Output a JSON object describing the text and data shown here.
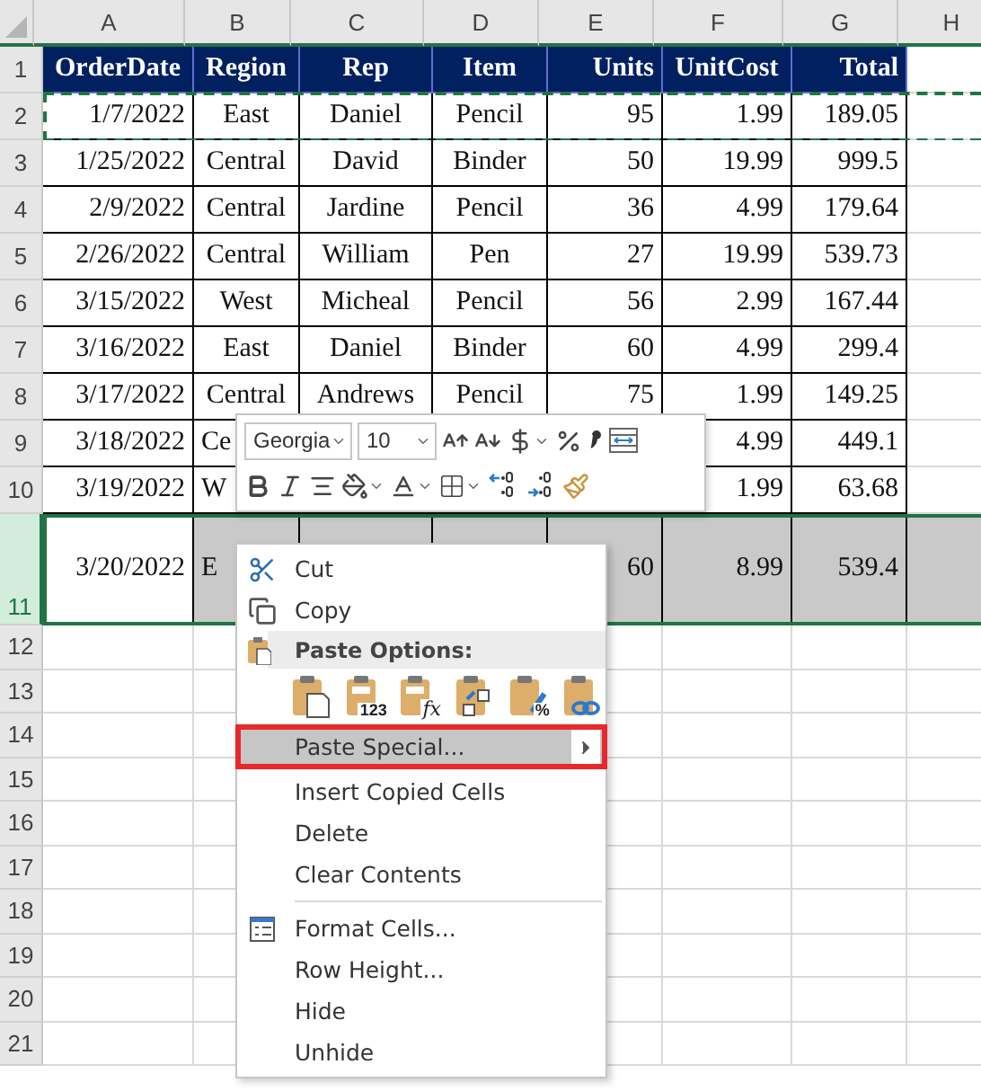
{
  "sheet": {
    "columns": [
      "A",
      "B",
      "C",
      "D",
      "E",
      "F",
      "G",
      "H"
    ],
    "rows": [
      {
        "label": "1",
        "kind": "header",
        "selected": false,
        "copied": false,
        "cells": [
          "OrderDate",
          "Region",
          "Rep",
          "Item",
          "Units",
          "UnitCost",
          "Total"
        ]
      },
      {
        "label": "2",
        "kind": "data",
        "selected": false,
        "copied": true,
        "cells": [
          "1/7/2022",
          "East",
          "Daniel",
          "Pencil",
          "95",
          "1.99",
          "189.05"
        ]
      },
      {
        "label": "3",
        "kind": "data",
        "selected": false,
        "copied": false,
        "cells": [
          "1/25/2022",
          "Central",
          "David",
          "Binder",
          "50",
          "19.99",
          "999.5"
        ]
      },
      {
        "label": "4",
        "kind": "data",
        "selected": false,
        "copied": false,
        "cells": [
          "2/9/2022",
          "Central",
          "Jardine",
          "Pencil",
          "36",
          "4.99",
          "179.64"
        ]
      },
      {
        "label": "5",
        "kind": "data",
        "selected": false,
        "copied": false,
        "cells": [
          "2/26/2022",
          "Central",
          "William",
          "Pen",
          "27",
          "19.99",
          "539.73"
        ]
      },
      {
        "label": "6",
        "kind": "data",
        "selected": false,
        "copied": false,
        "cells": [
          "3/15/2022",
          "West",
          "Micheal",
          "Pencil",
          "56",
          "2.99",
          "167.44"
        ]
      },
      {
        "label": "7",
        "kind": "data",
        "selected": false,
        "copied": false,
        "cells": [
          "3/16/2022",
          "East",
          "Daniel",
          "Binder",
          "60",
          "4.99",
          "299.4"
        ]
      },
      {
        "label": "8",
        "kind": "data",
        "selected": false,
        "copied": false,
        "cells": [
          "3/17/2022",
          "Central",
          "Andrews",
          "Pencil",
          "75",
          "1.99",
          "149.25"
        ]
      },
      {
        "label": "9",
        "kind": "data",
        "selected": false,
        "copied": false,
        "cells": [
          "3/18/2022",
          {
            "text": "Ce",
            "cut": true
          },
          null,
          null,
          null,
          "4.99",
          "449.1"
        ]
      },
      {
        "label": "10",
        "kind": "data",
        "selected": false,
        "copied": false,
        "cells": [
          "3/19/2022",
          {
            "text": "W",
            "cut": true
          },
          null,
          null,
          null,
          "1.99",
          "63.68"
        ]
      },
      {
        "label": "11",
        "kind": "data",
        "selected": true,
        "copied": false,
        "cells": [
          "3/20/2022",
          {
            "text": "E",
            "cut": true
          },
          null,
          null,
          "60",
          "8.99",
          "539.4"
        ]
      },
      {
        "label": "12",
        "kind": "empty",
        "selected": false,
        "copied": false
      },
      {
        "label": "13",
        "kind": "empty",
        "selected": false,
        "copied": false
      },
      {
        "label": "14",
        "kind": "empty",
        "selected": false,
        "copied": false
      },
      {
        "label": "15",
        "kind": "empty",
        "selected": false,
        "copied": false
      },
      {
        "label": "16",
        "kind": "empty",
        "selected": false,
        "copied": false
      },
      {
        "label": "17",
        "kind": "empty",
        "selected": false,
        "copied": false
      },
      {
        "label": "18",
        "kind": "empty",
        "selected": false,
        "copied": false
      },
      {
        "label": "19",
        "kind": "empty",
        "selected": false,
        "copied": false
      },
      {
        "label": "20",
        "kind": "empty",
        "selected": false,
        "copied": false
      },
      {
        "label": "21",
        "kind": "empty",
        "selected": false,
        "copied": false
      }
    ]
  },
  "mini_toolbar": {
    "font": "Georgia",
    "size": "10"
  },
  "context_menu": {
    "items": [
      {
        "kind": "command",
        "label": "Cut",
        "highlighted": false,
        "marked": false
      },
      {
        "kind": "command",
        "label": "Copy",
        "highlighted": false,
        "marked": false
      },
      {
        "kind": "header",
        "label": "Paste Options:"
      },
      {
        "kind": "paste_options",
        "options": [
          {
            "kind": "paste"
          },
          {
            "kind": "values",
            "badge": "123"
          },
          {
            "kind": "formulas",
            "badge": "fx"
          },
          {
            "kind": "transpose"
          },
          {
            "kind": "formatting",
            "badge": "%"
          },
          {
            "kind": "link"
          }
        ]
      },
      {
        "kind": "submenu",
        "label": "Paste Special...",
        "highlighted": true,
        "marked": true
      },
      {
        "kind": "command",
        "label": "Insert Copied Cells",
        "highlighted": false,
        "marked": false
      },
      {
        "kind": "command",
        "label": "Delete",
        "highlighted": false,
        "marked": false
      },
      {
        "kind": "command",
        "label": "Clear Contents",
        "highlighted": false,
        "marked": false
      },
      {
        "kind": "separator"
      },
      {
        "kind": "command",
        "label": "Format Cells...",
        "highlighted": false,
        "marked": false
      },
      {
        "kind": "command",
        "label": "Row Height...",
        "highlighted": false,
        "marked": false
      },
      {
        "kind": "command",
        "label": "Hide",
        "highlighted": false,
        "marked": false
      },
      {
        "kind": "command",
        "label": "Unhide",
        "highlighted": false,
        "marked": false
      }
    ]
  }
}
